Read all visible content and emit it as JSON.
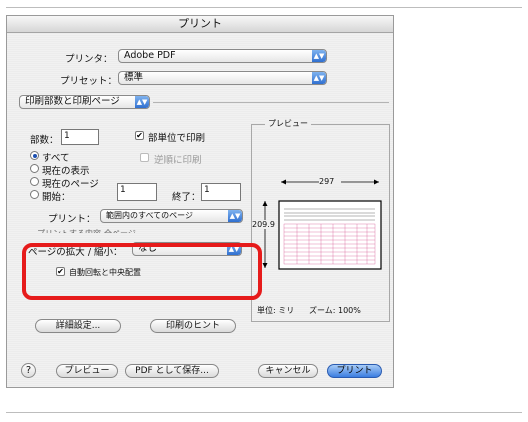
{
  "window": {
    "title": "プリント"
  },
  "printer": {
    "label": "プリンタ：",
    "value": "Adobe PDF"
  },
  "preset": {
    "label": "プリセット：",
    "value": "標準"
  },
  "panel_popup": {
    "value": "印刷部数と印刷ページ"
  },
  "copies": {
    "label": "部数：",
    "value": "1"
  },
  "collate": {
    "label": "部単位で印刷",
    "checked": true
  },
  "reverse": {
    "label": "逆順に印刷",
    "checked": false
  },
  "pages": {
    "all": "すべて",
    "current_view": "現在の表示",
    "current_page": "現在のページ",
    "start": "開始：",
    "start_value": "1",
    "end": "終了：",
    "end_value": "1"
  },
  "print_what": {
    "label": "プリント：",
    "value": "範囲内のすべてのページ"
  },
  "print_subset": {
    "label": "プリントする内容",
    "value": "全ページ"
  },
  "scaling": {
    "label": "ページの拡大 / 縮小：",
    "value": "なし"
  },
  "auto_rotate": {
    "label": "自動回転と中央配置",
    "checked": true
  },
  "preview_box": {
    "title": "プレビュー",
    "width_label": "297",
    "height_label": "209.9",
    "unit": "単位: ミリ",
    "zoom": "ズーム: 100%"
  },
  "buttons": {
    "advanced": "詳細設定...",
    "hints": "印刷のヒント",
    "help": "?",
    "preview": "プレビュー",
    "save_pdf": "PDF として保存...",
    "cancel": "キャンセル",
    "print": "プリント"
  },
  "colors": {
    "highlight": "#e61b1b",
    "accent": "#3b7de0"
  }
}
